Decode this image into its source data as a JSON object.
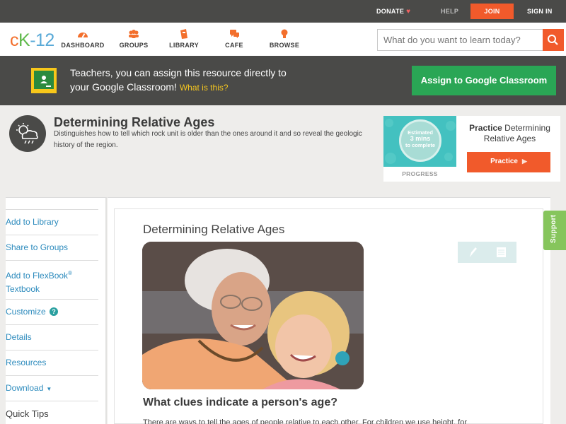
{
  "topbar": {
    "donate": "DONATE",
    "help": "HELP",
    "join": "JOIN",
    "sign_in": "SIGN IN"
  },
  "logo": {
    "c": "c",
    "k": "K",
    "rest": "-12"
  },
  "nav": {
    "items": [
      {
        "label": "DASHBOARD",
        "icon": "dashboard-icon"
      },
      {
        "label": "GROUPS",
        "icon": "groups-icon"
      },
      {
        "label": "LIBRARY",
        "icon": "library-icon"
      },
      {
        "label": "CAFE",
        "icon": "cafe-icon"
      },
      {
        "label": "BROWSE",
        "icon": "browse-icon"
      }
    ]
  },
  "search": {
    "placeholder": "What do you want to learn today?",
    "icon": "search-icon"
  },
  "banner": {
    "line1": "Teachers, you can assign this resource directly to",
    "line2": "your Google Classroom!",
    "what_link": "What is this?",
    "assign_button": "Assign to Google Classroom"
  },
  "concept": {
    "title": "Determining Relative Ages",
    "description": "Distinguishes how to tell which rock unit is older than the ones around it and so reveal the geologic history of the region.",
    "icon": "weather-cloud-icon"
  },
  "practice": {
    "estimated": "Estimated",
    "mins": "3 mins",
    "to_complete": "to complete",
    "progress_label": "PROGRESS",
    "title_bold": "Practice",
    "title_rest": "Determining Relative Ages",
    "button": "Practice"
  },
  "sidebar": {
    "add_library": "Add to Library",
    "share_groups": "Share to Groups",
    "add_flexbook_1": "Add to FlexBook",
    "add_flexbook_reg": "®",
    "add_flexbook_2": "Textbook",
    "customize": "Customize",
    "customize_help": "?",
    "details": "Details",
    "resources": "Resources",
    "download": "Download",
    "quick_tips": "Quick Tips"
  },
  "article": {
    "title": "Determining Relative Ages",
    "heading": "What clues indicate a person's age?",
    "paragraph": "There are ways to tell the ages of people relative to each other. For children we use height, for"
  },
  "support": "Support",
  "colors": {
    "accent": "#f15a2b",
    "google_green": "#2aa655",
    "link": "#2d8bbd",
    "dark_bar": "#4a4a48",
    "support_green": "#86c55c"
  }
}
